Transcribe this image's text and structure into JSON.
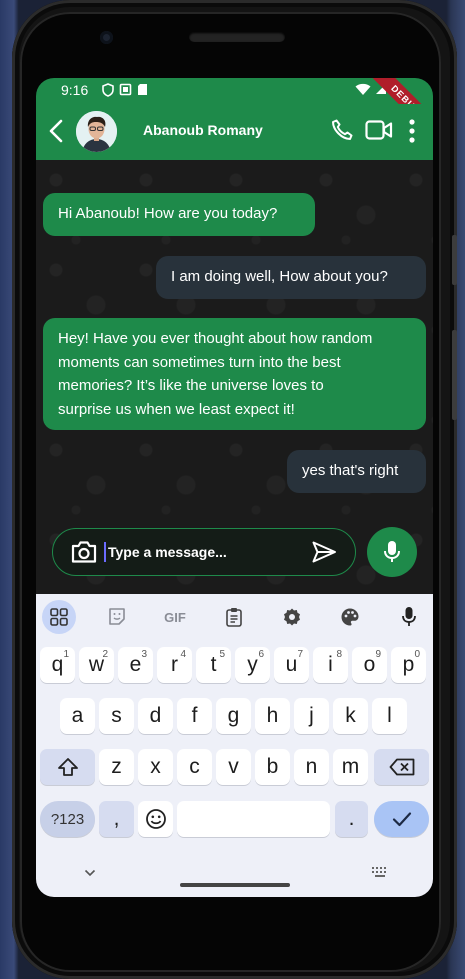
{
  "status_bar": {
    "time": "9:16",
    "debug_label": "DEBUG"
  },
  "app_bar": {
    "contact_name": "Abanoub Romany"
  },
  "messages": [
    {
      "type": "received",
      "lines": [
        "Hi Abanoub! How are you today?"
      ]
    },
    {
      "type": "sent",
      "lines": [
        "I am doing well, How about you?"
      ]
    },
    {
      "type": "received",
      "lines": [
        "Hey! Have you ever thought about how random",
        "moments can sometimes turn into the best",
        "memories? It’s like the universe loves to",
        "surprise us when we least expect it!"
      ]
    },
    {
      "type": "sent",
      "lines": [
        "yes that's right"
      ]
    }
  ],
  "composer": {
    "placeholder": "Type a message..."
  },
  "keyboard": {
    "toolbar": {
      "gif_label": "GIF"
    },
    "row1": [
      {
        "k": "q",
        "n": "1"
      },
      {
        "k": "w",
        "n": "2"
      },
      {
        "k": "e",
        "n": "3"
      },
      {
        "k": "r",
        "n": "4"
      },
      {
        "k": "t",
        "n": "5"
      },
      {
        "k": "y",
        "n": "6"
      },
      {
        "k": "u",
        "n": "7"
      },
      {
        "k": "i",
        "n": "8"
      },
      {
        "k": "o",
        "n": "9"
      },
      {
        "k": "p",
        "n": "0"
      }
    ],
    "row2": [
      "a",
      "s",
      "d",
      "f",
      "g",
      "h",
      "j",
      "k",
      "l"
    ],
    "row3": [
      "z",
      "x",
      "c",
      "v",
      "b",
      "n",
      "m"
    ],
    "symbols_label": "?123",
    "comma_label": ",",
    "period_label": "."
  },
  "colors": {
    "accent": "#1e8a4a",
    "sent_bubble": "#28323b",
    "chat_bg": "#1b1b1b",
    "keyboard_bg": "#eef0f8"
  }
}
